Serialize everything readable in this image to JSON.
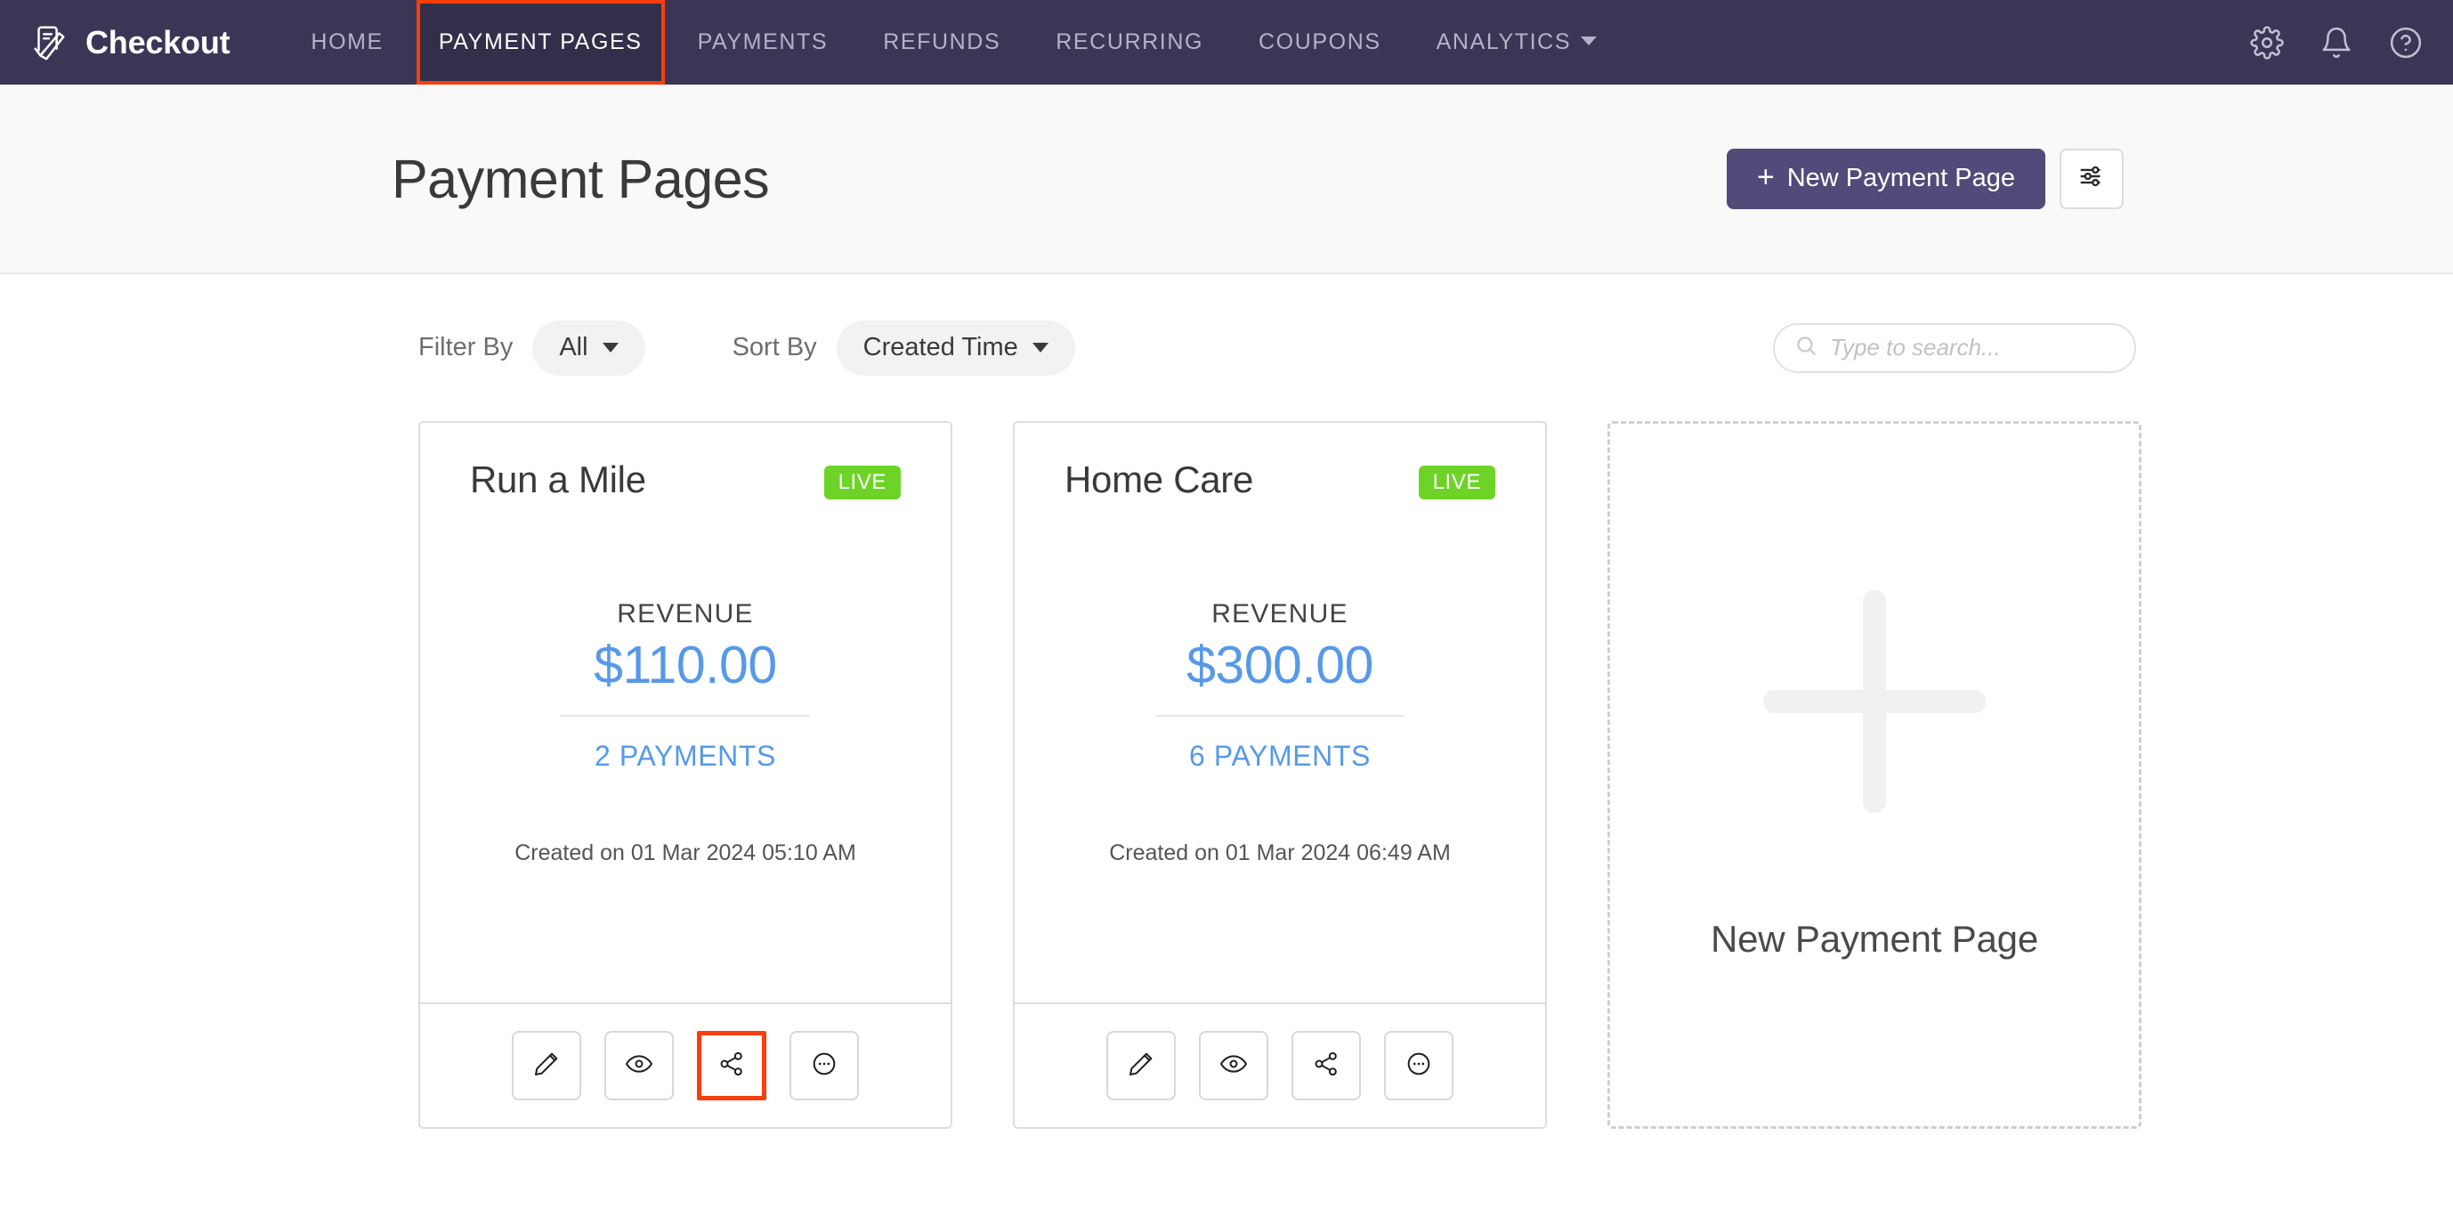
{
  "brand": {
    "name": "Checkout",
    "logo_icon": "document-check-icon"
  },
  "nav": {
    "items": [
      {
        "label": "HOME",
        "active": false,
        "has_caret": false
      },
      {
        "label": "PAYMENT PAGES",
        "active": true,
        "has_caret": false
      },
      {
        "label": "PAYMENTS",
        "active": false,
        "has_caret": false
      },
      {
        "label": "REFUNDS",
        "active": false,
        "has_caret": false
      },
      {
        "label": "RECURRING",
        "active": false,
        "has_caret": false
      },
      {
        "label": "COUPONS",
        "active": false,
        "has_caret": false
      },
      {
        "label": "ANALYTICS",
        "active": false,
        "has_caret": true
      }
    ],
    "right_icons": [
      "gear-icon",
      "bell-icon",
      "help-icon"
    ]
  },
  "header": {
    "title": "Payment Pages",
    "new_button_label": "New Payment Page",
    "new_button_plus": "+",
    "settings_icon": "sliders-icon"
  },
  "filters": {
    "filter_label": "Filter By",
    "filter_value": "All",
    "sort_label": "Sort By",
    "sort_value": "Created Time"
  },
  "search": {
    "placeholder": "Type to search...",
    "value": "",
    "icon": "search-icon"
  },
  "cards": [
    {
      "title": "Run a Mile",
      "status": "LIVE",
      "revenue_label": "REVENUE",
      "revenue_value": "$110.00",
      "payments_text": "2 PAYMENTS",
      "created_text": "Created on 01 Mar 2024 05:10 AM",
      "actions": [
        {
          "name": "edit-button",
          "icon": "pencil-icon",
          "highlighted": false
        },
        {
          "name": "preview-button",
          "icon": "eye-icon",
          "highlighted": false
        },
        {
          "name": "share-button",
          "icon": "share-icon",
          "highlighted": true
        },
        {
          "name": "more-button",
          "icon": "ellipsis-icon",
          "highlighted": false
        }
      ]
    },
    {
      "title": "Home Care",
      "status": "LIVE",
      "revenue_label": "REVENUE",
      "revenue_value": "$300.00",
      "payments_text": "6 PAYMENTS",
      "created_text": "Created on 01 Mar 2024 06:49 AM",
      "actions": [
        {
          "name": "edit-button",
          "icon": "pencil-icon",
          "highlighted": false
        },
        {
          "name": "preview-button",
          "icon": "eye-icon",
          "highlighted": false
        },
        {
          "name": "share-button",
          "icon": "share-icon",
          "highlighted": false
        },
        {
          "name": "more-button",
          "icon": "ellipsis-icon",
          "highlighted": false
        }
      ]
    }
  ],
  "new_card": {
    "label": "New Payment Page",
    "icon": "plus-icon"
  },
  "colors": {
    "nav_background": "#3B3656",
    "accent_primary": "#514B7A",
    "status_live": "#6DD427",
    "revenue_blue": "#5799E8",
    "highlight_outline": "#F93E0C",
    "page_header_background": "#F9F9F9"
  }
}
